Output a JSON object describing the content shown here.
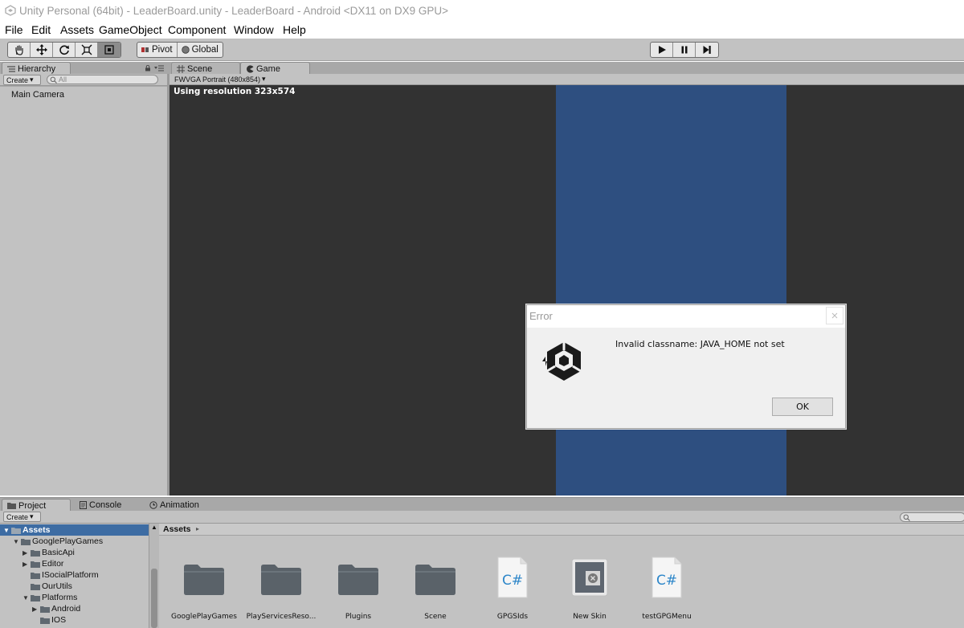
{
  "window": {
    "title": "Unity Personal (64bit) - LeaderBoard.unity - LeaderBoard - Android <DX11 on DX9 GPU>"
  },
  "menu": [
    "File",
    "Edit",
    "Assets",
    "GameObject",
    "Component",
    "Window",
    "Help"
  ],
  "toolbar": {
    "transform_tools": [
      "hand-tool-icon",
      "move-tool-icon",
      "rotate-tool-icon",
      "scale-tool-icon",
      "rect-tool-icon"
    ],
    "pivot_label": "Pivot",
    "global_label": "Global",
    "play_controls": [
      "play-icon",
      "pause-icon",
      "step-icon"
    ]
  },
  "hierarchy": {
    "tab_label": "Hierarchy",
    "create_label": "Create",
    "search_placeholder": "All",
    "items": [
      "Main Camera"
    ]
  },
  "scene_tab_label": "Scene",
  "game": {
    "tab_label": "Game",
    "aspect_label": "FWVGA Portrait (480x854)",
    "resolution_text": "Using resolution 323x574",
    "canvas_color": "#2e4f80"
  },
  "dialog": {
    "title": "Error",
    "message": "Invalid classname: JAVA_HOME not set",
    "ok_label": "OK"
  },
  "bottom": {
    "tabs": [
      "Project",
      "Console",
      "Animation"
    ],
    "create_label": "Create",
    "tree": [
      {
        "label": "Assets",
        "depth": 0,
        "expanded": true,
        "selected": true
      },
      {
        "label": "GooglePlayGames",
        "depth": 1,
        "expanded": true
      },
      {
        "label": "BasicApi",
        "depth": 2,
        "collapsed": true
      },
      {
        "label": "Editor",
        "depth": 2,
        "collapsed": true
      },
      {
        "label": "ISocialPlatform",
        "depth": 2
      },
      {
        "label": "OurUtils",
        "depth": 2
      },
      {
        "label": "Platforms",
        "depth": 2,
        "expanded": true
      },
      {
        "label": "Android",
        "depth": 3,
        "collapsed": true
      },
      {
        "label": "IOS",
        "depth": 3
      }
    ],
    "breadcrumb": "Assets",
    "assets": [
      {
        "label": "GooglePlayGames",
        "kind": "folder"
      },
      {
        "label": "PlayServicesReso...",
        "kind": "folder"
      },
      {
        "label": "Plugins",
        "kind": "folder"
      },
      {
        "label": "Scene",
        "kind": "folder"
      },
      {
        "label": "GPGSIds",
        "kind": "csharp"
      },
      {
        "label": "New Skin",
        "kind": "guiskin"
      },
      {
        "label": "testGPGMenu",
        "kind": "csharp"
      }
    ]
  },
  "colors": {
    "selection": "#3d6ca3",
    "panel": "#c2c2c2",
    "viewport": "#323232"
  }
}
